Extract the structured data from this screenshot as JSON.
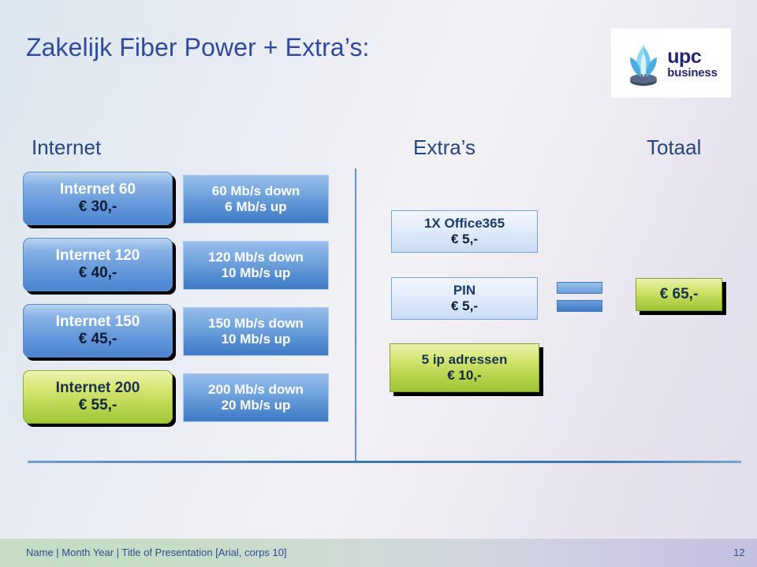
{
  "slide": {
    "title": "Zakelijk Fiber Power + Extra’s:",
    "logo": {
      "icon": "lotus-flower-icon",
      "brand": "upc",
      "sub": "business"
    }
  },
  "columns": {
    "internet_header": "Internet",
    "extras_header": "Extra’s",
    "totaal_header": "Totaal"
  },
  "plans": [
    {
      "name": "Internet 60",
      "price": "€ 30,-",
      "down": "60 Mb/s down",
      "up": "6 Mb/s up",
      "highlight": false
    },
    {
      "name": "Internet 120",
      "price": "€ 40,-",
      "down": "120 Mb/s down",
      "up": "10 Mb/s up",
      "highlight": false
    },
    {
      "name": "Internet 150",
      "price": "€ 45,-",
      "down": "150 Mb/s down",
      "up": "10 Mb/s up",
      "highlight": false
    },
    {
      "name": "Internet 200",
      "price": "€ 55,-",
      "down": "200 Mb/s down",
      "up": "20 Mb/s up",
      "highlight": true
    }
  ],
  "extras": [
    {
      "name": "1X Office365",
      "price": "€ 5,-",
      "highlight": false
    },
    {
      "name": "PIN",
      "price": "€ 5,-",
      "highlight": false
    },
    {
      "name": "5 ip adressen",
      "price": "€ 10,-",
      "highlight": true
    }
  ],
  "total": {
    "equals_icon": "equals-sign-icon",
    "amount": "€ 65,-"
  },
  "footer": {
    "text": "Name | Month Year | Title of Presentation [Arial, corps 10]",
    "page": "12"
  },
  "colors": {
    "title_blue": "#2f4a9e",
    "header_blue": "#25457e",
    "plan_blue": "#5f94d8",
    "speed_blue": "#4e87cd",
    "highlight_green": "#b6d44c",
    "divider_blue": "#3f76b4"
  }
}
